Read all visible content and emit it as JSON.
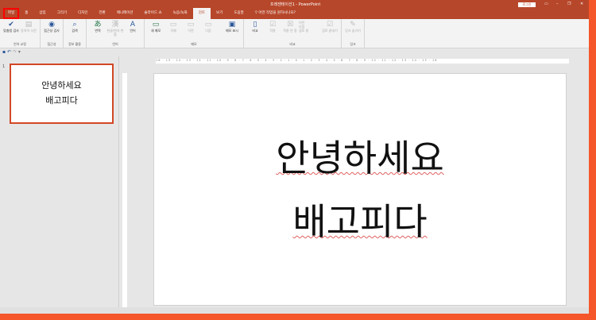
{
  "title": "프레젠테이션1 - PowerPoint",
  "signin": "로그인",
  "tabs": [
    "파일",
    "홈",
    "삽입",
    "그리기",
    "디자인",
    "전환",
    "애니메이션",
    "슬라이드 쇼",
    "녹음/녹화",
    "검토",
    "보기",
    "도움말",
    "어떤 작업을 원하시나요?"
  ],
  "ribbon": {
    "proofing": {
      "label": "언어 교정",
      "spell": "맞춤법 검사",
      "thesaurus": "동의어 사전"
    },
    "access": {
      "label": "접근성",
      "check": "접근성 검사"
    },
    "insights": {
      "label": "정보 활용",
      "search": "검색"
    },
    "language": {
      "label": "언어",
      "translate": "번역",
      "hanja": "한글/한자 변환",
      "lang": "언어"
    },
    "comments": {
      "label": "메모",
      "new": "새 메모",
      "delete": "삭제",
      "prev": "이전",
      "next": "다음",
      "show": "메모 표시"
    },
    "compare": {
      "label": "비교",
      "compare": "비교",
      "accept": "적용",
      "reject": "적용 안 함",
      "prev": "이전",
      "next": "다음",
      "pane": "검토 창",
      "end": "검토 끝내기"
    },
    "ink": {
      "label": "잉크",
      "hide": "잉크 숨기기"
    }
  },
  "slide": {
    "number": "1",
    "line1": "안녕하세요",
    "line2": "배고피다"
  },
  "ruler": "16 · 15 · 14 · 13 · 12 · 11 · 10 · 9 · 8 · 7 · 6 · 5 · 4 · 3 · 2 · 1 · 0 · 1 · 2 · 3 · 4 · 5 · 6 · 7 · 8 · 9 · 10 · 11 · 12 · 13 · 14 · 15 · 16"
}
